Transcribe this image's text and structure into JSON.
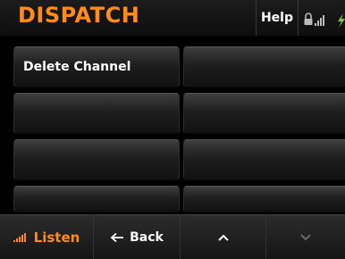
{
  "header": {
    "title": "DISPATCH",
    "help_label": "Help",
    "status_icons": [
      "lock-icon",
      "signal-bars-icon",
      "battery-charging-icon"
    ]
  },
  "grid": {
    "buttons": [
      {
        "label": "Delete Channel"
      },
      {
        "label": ""
      },
      {
        "label": ""
      },
      {
        "label": ""
      },
      {
        "label": ""
      },
      {
        "label": ""
      },
      {
        "label": ""
      },
      {
        "label": ""
      }
    ]
  },
  "footer": {
    "listen_label": "Listen",
    "back_label": "Back",
    "up_icon": "chevron-up-icon",
    "down_icon": "chevron-down-icon"
  },
  "colors": {
    "accent": "#ff8c1a",
    "background": "#000000",
    "text": "#ffffff",
    "battery": "#7cc63a"
  }
}
